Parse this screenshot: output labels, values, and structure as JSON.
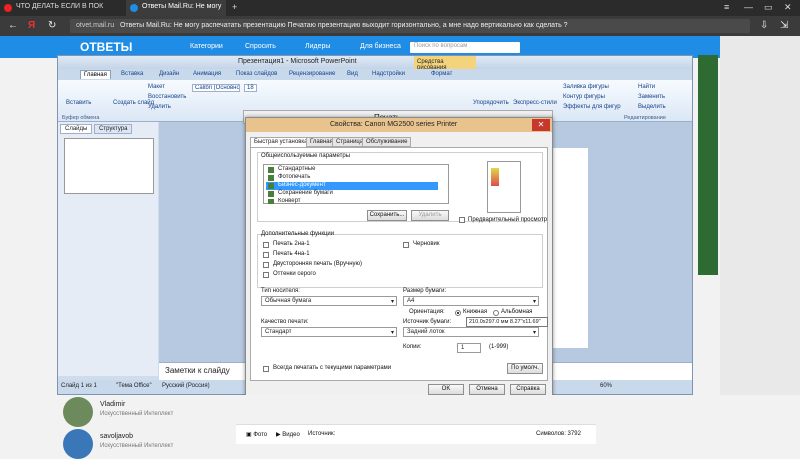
{
  "browser": {
    "tabs": [
      {
        "label": "ЧТО ДЕЛАТЬ ЕСЛИ В ПОК",
        "active": false
      },
      {
        "label": "Ответы Mail.Ru: Не могу",
        "active": true
      }
    ],
    "new_tab": "+",
    "address_domain": "otvet.mail.ru",
    "address_title": "Ответы Mail.Ru: Не могу распечатать презентацию Печатаю презентацию выходит горизонтально, а мне надо вертикально как сделать ?",
    "accent": "#1f8de5"
  },
  "site": {
    "logo": "ОТВЕТЫ",
    "nav": [
      "Категории",
      "Спросить",
      "Лидеры",
      "Для бизнеса"
    ],
    "search_placeholder": "Поиск по вопросам"
  },
  "ppt": {
    "title": "Презентация1 - Microsoft PowerPoint",
    "context_tools": "Средства рисования",
    "ribbon_tabs": [
      "Главная",
      "Вставка",
      "Дизайн",
      "Анимация",
      "Показ слайдов",
      "Рецензирование",
      "Вид",
      "Надстройки",
      "Формат"
    ],
    "ribbon": {
      "paste": "Вставить",
      "create_slide": "Создать слайд",
      "layout": "Макет",
      "restore": "Восстановить",
      "delete": "Удалить",
      "font": "Calibri (Основно",
      "font_size": "18",
      "arrange": "Упорядочить",
      "express": "Экспресс-стили",
      "fill": "Заливка фигуры",
      "outline": "Контур фигуры",
      "effects": "Эффекты для фигур",
      "find": "Найти",
      "replace": "Заменить",
      "select": "Выделить",
      "groups": [
        "Буфер обмена",
        "Редактирование"
      ]
    },
    "pane_tabs": [
      "Слайды",
      "Структура"
    ],
    "notes": "Заметки к слайду",
    "status": {
      "slide": "Слайд 1 из 1",
      "theme": "\"Тема Office\"",
      "lang": "Русский (Россия)",
      "zoom": "60%"
    }
  },
  "print_window": {
    "title": "Печать"
  },
  "dialog": {
    "title": "Свойства: Canon MG2500 series Printer",
    "close": "✕",
    "tabs": [
      "Быстрая установка",
      "Главная",
      "Страница",
      "Обслуживание"
    ],
    "presets_label": "Общеиспользуемые параметры",
    "presets": [
      "Стандартные",
      "Фотопечать",
      "Бизнес-документ",
      "Сохранение бумаги",
      "Конверт"
    ],
    "selected_preset": 2,
    "save_btn": "Сохранить...",
    "delete_btn": "Удалить",
    "preview_label": "Предварительный просмотр",
    "extra_label": "Дополнительные функции",
    "extra_items": [
      "Печать 2на-1",
      "Печать 4на-1",
      "Двусторонняя печать (Вручную)",
      "Оттенки серого"
    ],
    "draft": "Черновик",
    "media_label": "Тип носителя:",
    "media_value": "Обычная бумага",
    "paper_label": "Размер бумаги:",
    "paper_value": "A4",
    "orientation_label": "Ориентация:",
    "portrait": "Книжная",
    "landscape": "Альбомная",
    "tooltip": "210.0x297.0 мм 8.27\"x11.69\"",
    "quality_label": "Качество печати:",
    "quality_value": "Стандарт",
    "source_label": "Источник бумаги:",
    "source_value": "Задний лоток",
    "copies_label": "Копии:",
    "copies_value": "1",
    "copies_range": "(1-999)",
    "always_print": "Всегда печатать с текущими параметрами",
    "defaults_btn": "По умолч.",
    "ok": "OK",
    "cancel": "Отмена",
    "help": "Справка"
  },
  "answers": [
    {
      "name": "Vladimir",
      "category": "Искусственный Интеллект"
    },
    {
      "name": "savoljavob",
      "category": "Искусственный Интеллект"
    }
  ],
  "answer_bar": {
    "photo": "Фото",
    "video": "Видео",
    "source": "Источник:",
    "chars": "Символов: 3792"
  }
}
